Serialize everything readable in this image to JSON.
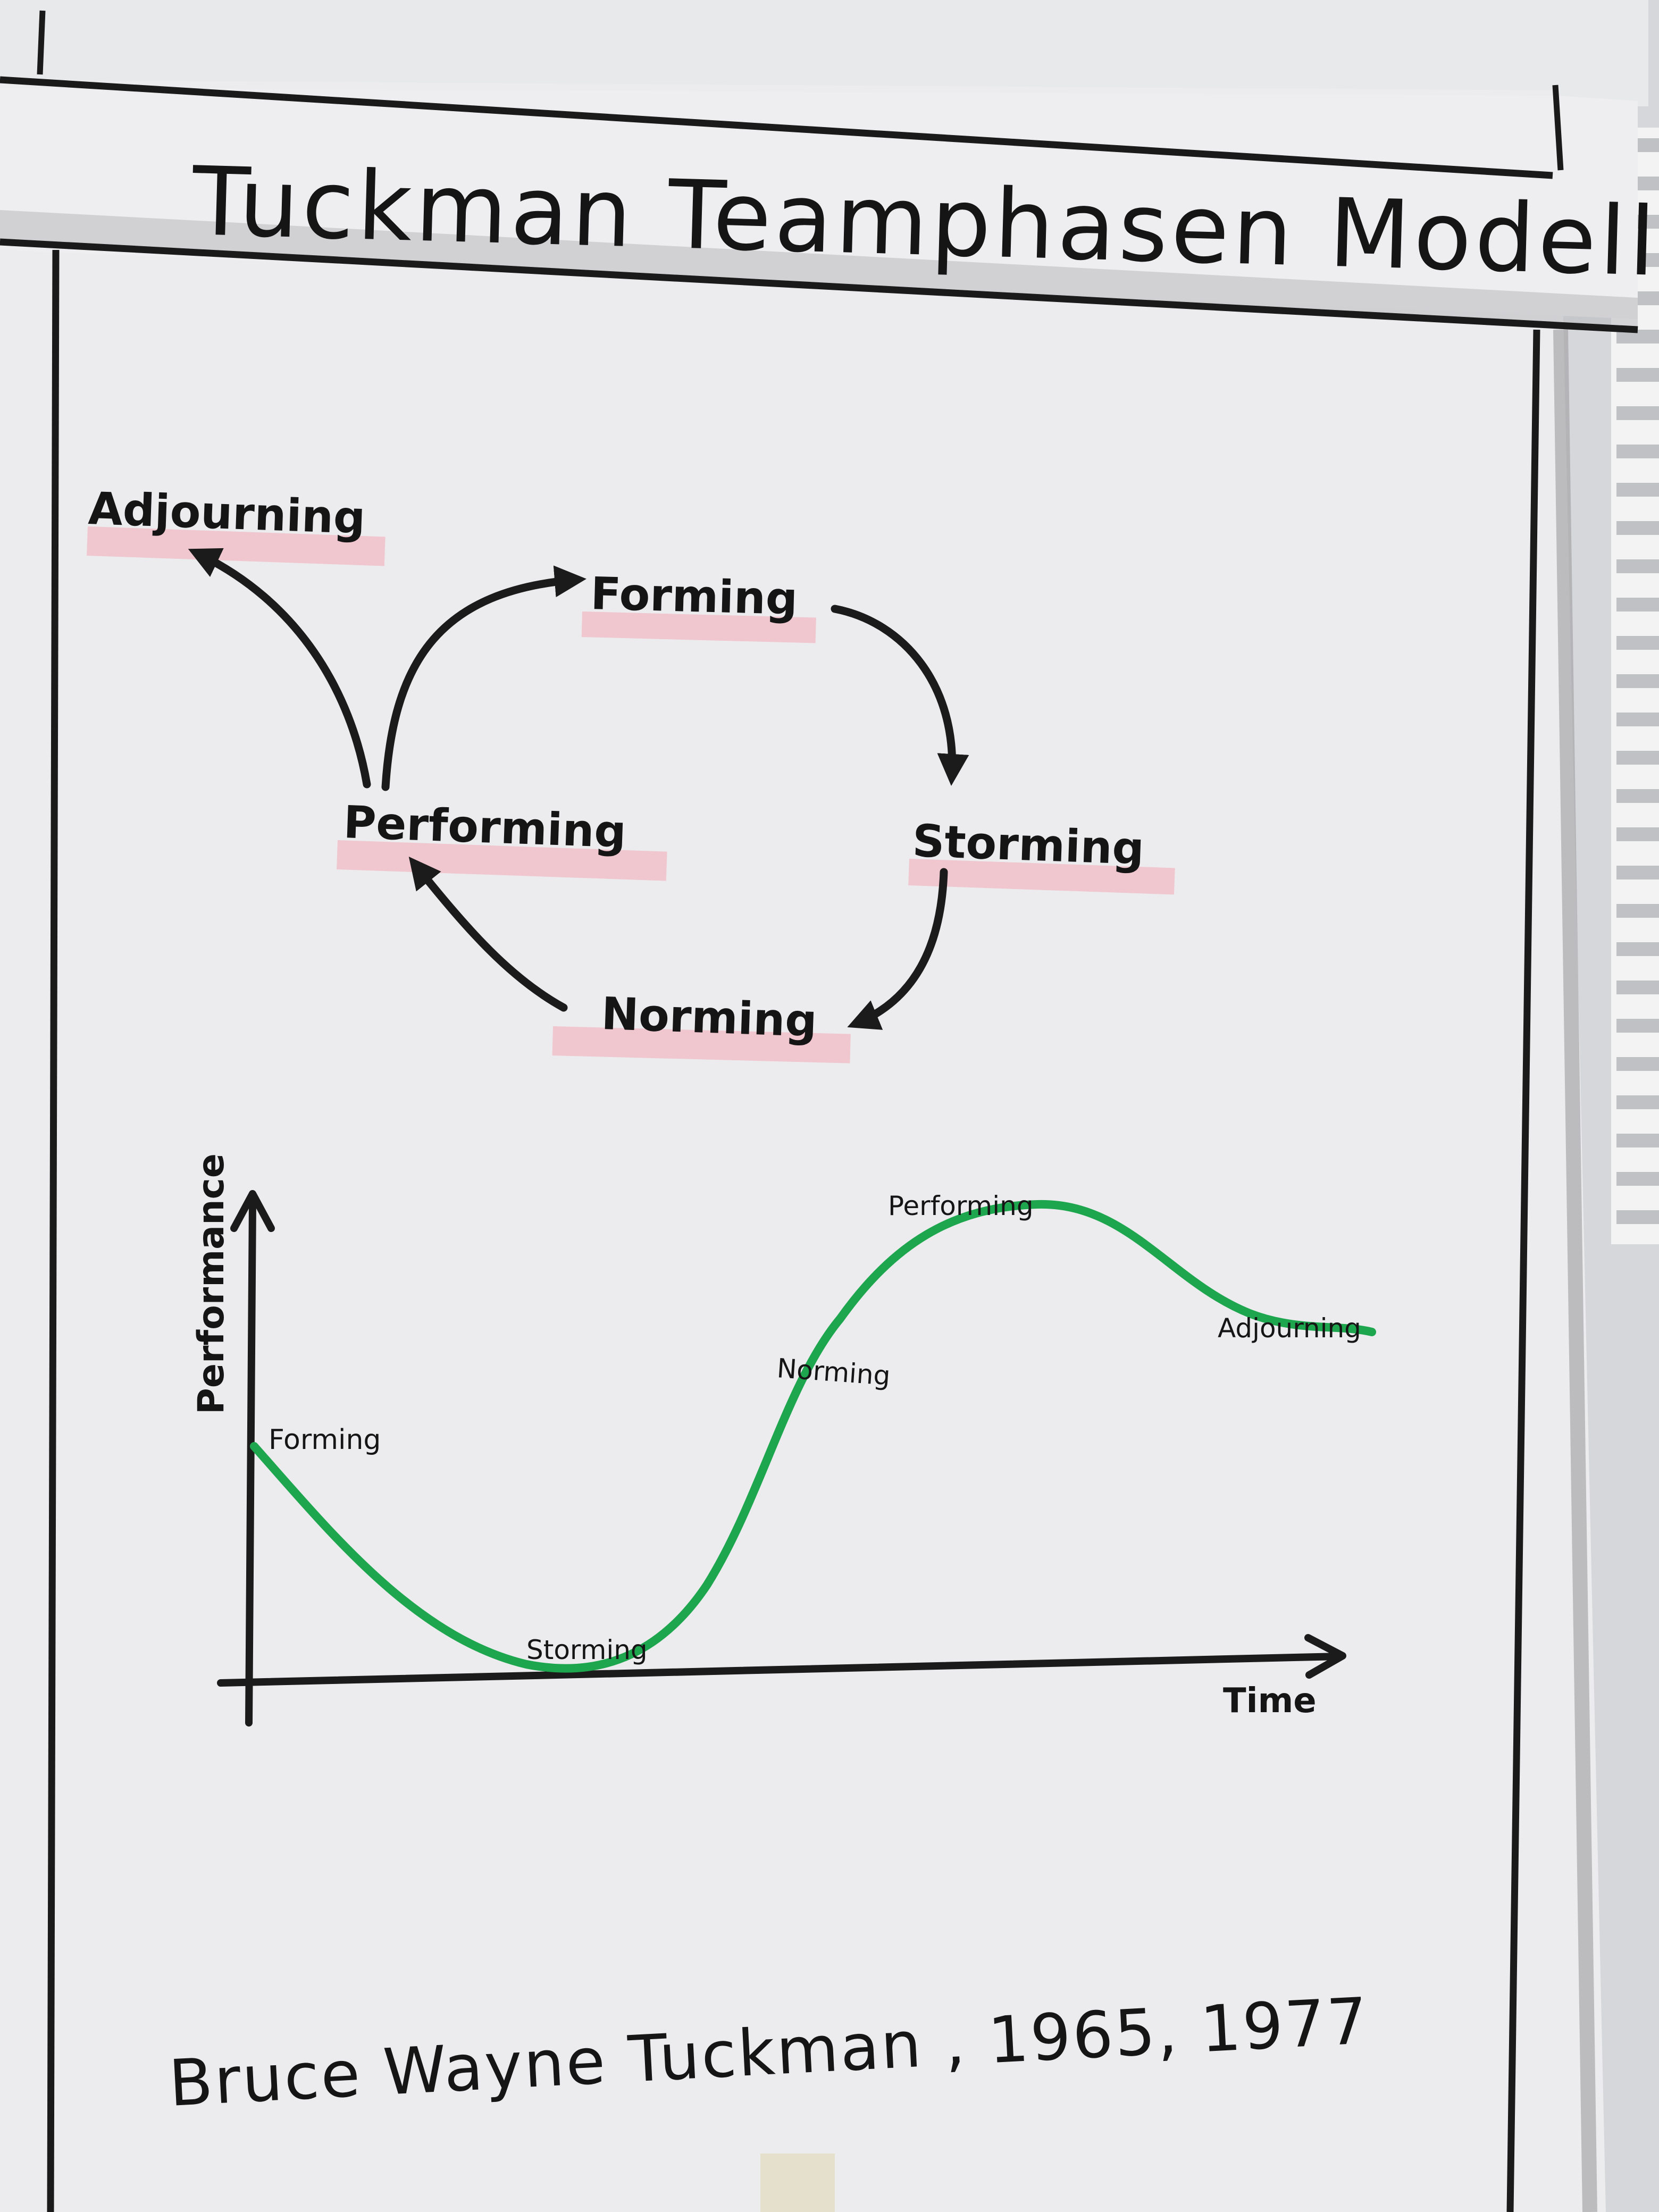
{
  "title": "Tuckman Teamphasen Modell",
  "footer": "Bruce Wayne Tuckman , 1965, 1977",
  "cycle": {
    "stages": [
      {
        "id": "adjourning",
        "label": "Adjourning"
      },
      {
        "id": "forming",
        "label": "Forming"
      },
      {
        "id": "storming",
        "label": "Storming"
      },
      {
        "id": "norming",
        "label": "Norming"
      },
      {
        "id": "performing",
        "label": "Performing"
      }
    ]
  },
  "chart": {
    "ylabel": "Performance",
    "xlabel": "Time",
    "points": [
      {
        "label": "Forming"
      },
      {
        "label": "Storming"
      },
      {
        "label": "Norming"
      },
      {
        "label": "Performing"
      },
      {
        "label": "Adjourning"
      }
    ]
  },
  "colors": {
    "ink": "#151515",
    "curve": "#1ea64f",
    "highlight": "#f2b9c4",
    "paper": "#ededef"
  }
}
